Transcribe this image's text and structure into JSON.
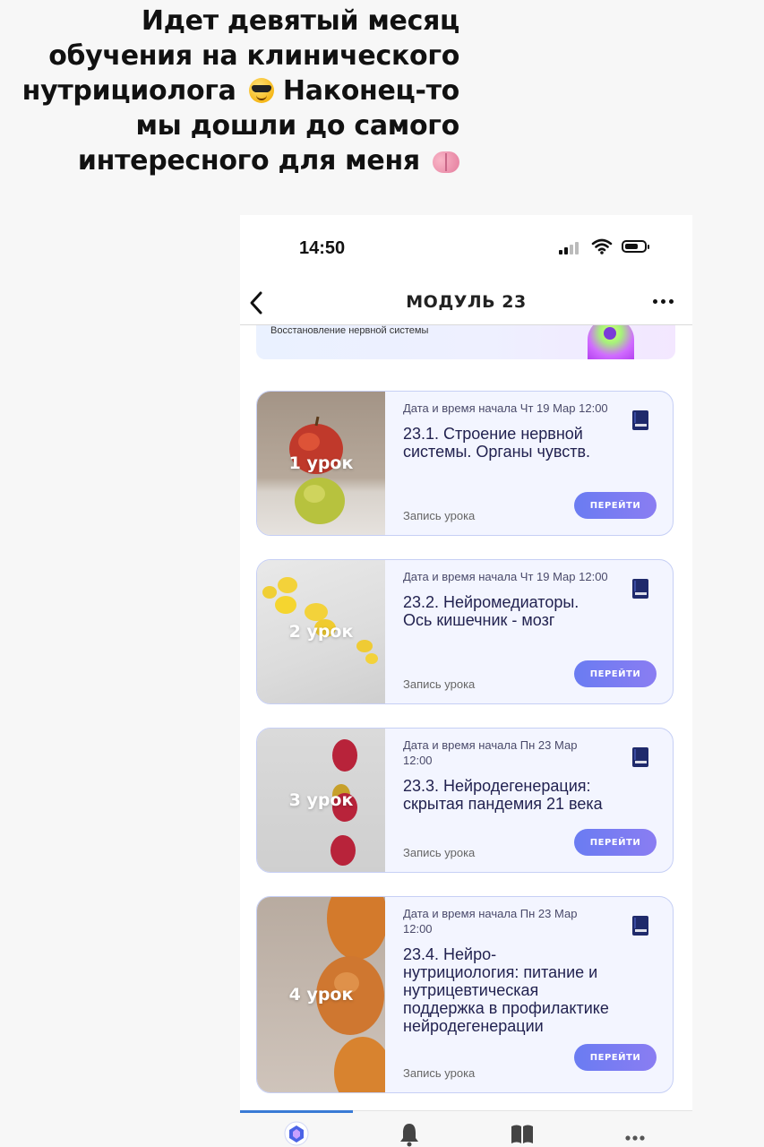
{
  "story": {
    "caption_lines": [
      "Идет девятый месяц",
      "обучения на клинического",
      "нутрициолога",
      "Наконец-то",
      "мы дошли до самого",
      "интересного для меня"
    ],
    "emoji_1": "smiling-face-with-sunglasses",
    "emoji_2": "brain"
  },
  "status": {
    "time": "14:50"
  },
  "nav": {
    "title": "МОДУЛЬ 23"
  },
  "module_banner": {
    "text": "Восстановление нервной системы"
  },
  "lessons": [
    {
      "number_label": "1 урок",
      "date": "Дата и время начала Чт 19 Мар 12:00",
      "title": "23.1. Строение нервной системы. Органы чувств.",
      "record": "Запись урока",
      "button": "ПЕРЕЙТИ",
      "image": "apples"
    },
    {
      "number_label": "2 урок",
      "date": "Дата и время начала Чт 19 Мар 12:00",
      "title": "23.2. Нейромедиаторы. Ось кишечник - мозг",
      "record": "Запись урока",
      "button": "ПЕРЕЙТИ",
      "image": "lemons"
    },
    {
      "number_label": "3 урок",
      "date": "Дата и время начала Пн 23 Мар 12:00",
      "title": "23.3. Нейродегенерация: скрытая пандемия 21 века",
      "record": "Запись урока",
      "button": "ПЕРЕЙТИ",
      "image": "raspberries"
    },
    {
      "number_label": "4 урок",
      "date": "Дата и время начала Пн 23 Мар 12:00",
      "title": "23.4. Нейро-нутрициология: питание и нутрицевтическая поддержка в профилактике нейродегенерации",
      "record": "Запись урока",
      "button": "ПЕРЕЙТИ",
      "image": "eggs"
    }
  ],
  "tabbar": {
    "tabs": [
      "home-icon",
      "bell-icon",
      "book-icon",
      "more-icon"
    ],
    "active_index": 0
  },
  "colors": {
    "accent": "#6a7cf2",
    "card_bg": "#f3f5ff",
    "card_border": "#c6cff5",
    "title_text": "#222250"
  }
}
